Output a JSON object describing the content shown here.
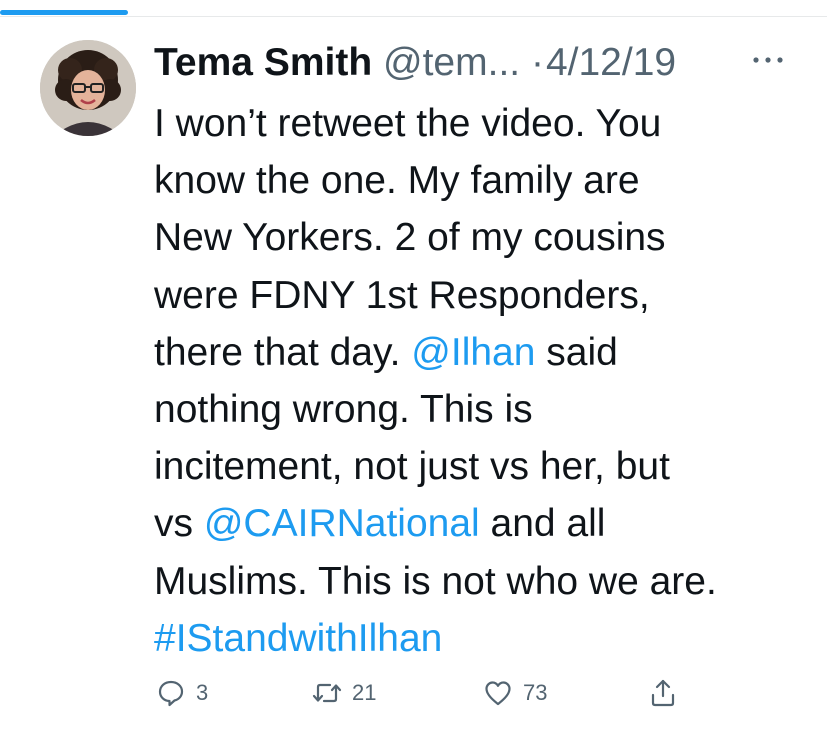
{
  "tweet": {
    "author_name": "Tema Smith",
    "author_handle": "@tem...",
    "separator": "·",
    "date": "4/12/19",
    "text_lines": [
      [
        {
          "t": "I won’t retweet the video. You"
        }
      ],
      [
        {
          "t": "know the one. My family are"
        }
      ],
      [
        {
          "t": "New Yorkers. 2 of my cousins"
        }
      ],
      [
        {
          "t": "were FDNY 1st Responders,"
        }
      ],
      [
        {
          "t": "there that day. "
        },
        {
          "t": "@Ilhan",
          "link": true
        },
        {
          "t": " said"
        }
      ],
      [
        {
          "t": "nothing wrong. This is"
        }
      ],
      [
        {
          "t": "incitement, not just vs her, but"
        }
      ],
      [
        {
          "t": "vs "
        },
        {
          "t": "@CAIRNational",
          "link": true
        },
        {
          "t": " and all"
        }
      ],
      [
        {
          "t": "Muslims. This is not who we are."
        }
      ],
      [
        {
          "t": "#IStandwithIlhan",
          "link": true
        }
      ]
    ],
    "metrics": {
      "replies": "3",
      "retweets": "21",
      "likes": "73"
    }
  },
  "icons": {
    "more": "more-horizontal-icon",
    "reply": "reply-icon",
    "retweet": "retweet-icon",
    "like": "heart-icon",
    "share": "share-icon"
  },
  "colors": {
    "accent": "#1d9bf0",
    "text_primary": "#0f1419",
    "text_secondary": "#536471"
  }
}
